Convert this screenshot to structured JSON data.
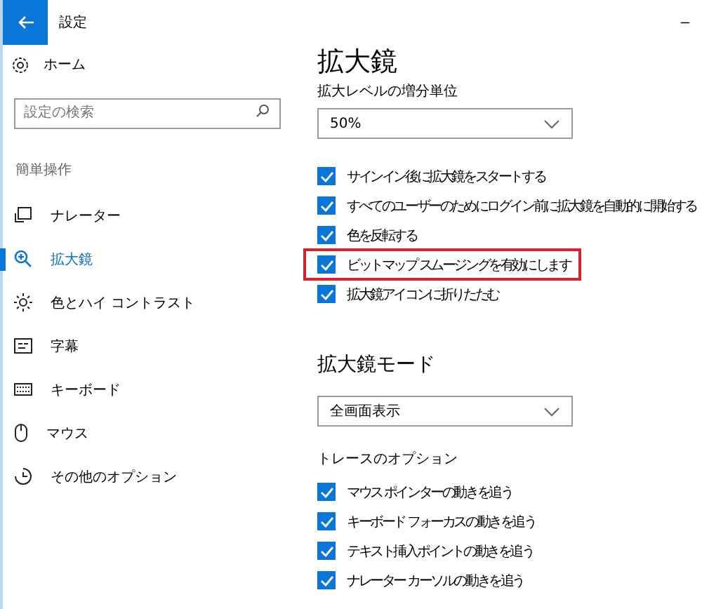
{
  "window": {
    "title": "設定",
    "minimize": "–"
  },
  "sidebar": {
    "home": "ホーム",
    "search": {
      "placeholder": "設定の検索"
    },
    "section": "簡単操作",
    "items": [
      {
        "label": "ナレーター",
        "selected": false
      },
      {
        "label": "拡大鏡",
        "selected": true
      },
      {
        "label": "色とハイ コントラスト",
        "selected": false
      },
      {
        "label": "字幕",
        "selected": false
      },
      {
        "label": "キーボード",
        "selected": false
      },
      {
        "label": "マウス",
        "selected": false
      },
      {
        "label": "その他のオプション",
        "selected": false
      }
    ]
  },
  "main": {
    "title": "拡大鏡",
    "zoom_label": "拡大レベルの増分単位",
    "zoom_value": "50%",
    "options": [
      {
        "label": "サインイン後に拡大鏡をスタートする",
        "checked": true,
        "highlighted": false
      },
      {
        "label": "すべてのユーザーのためにログイン前に拡大鏡を自動的に開始する",
        "checked": true,
        "highlighted": false
      },
      {
        "label": "色を反転する",
        "checked": true,
        "highlighted": false
      },
      {
        "label": "ビットマップ スムージングを有効にします",
        "checked": true,
        "highlighted": true
      },
      {
        "label": "拡大鏡アイコンに折りたたむ",
        "checked": true,
        "highlighted": false
      }
    ],
    "mode_heading": "拡大鏡モード",
    "mode_value": "全画面表示",
    "tracking_label": "トレースのオプション",
    "tracking": [
      {
        "label": "マウス ポインターの動きを追う",
        "checked": true
      },
      {
        "label": "キーボード フォーカスの動きを追う",
        "checked": true
      },
      {
        "label": "テキスト挿入ポイントの動きを追う",
        "checked": true
      },
      {
        "label": "ナレーター カーソルの動きを追う",
        "checked": true
      }
    ]
  }
}
